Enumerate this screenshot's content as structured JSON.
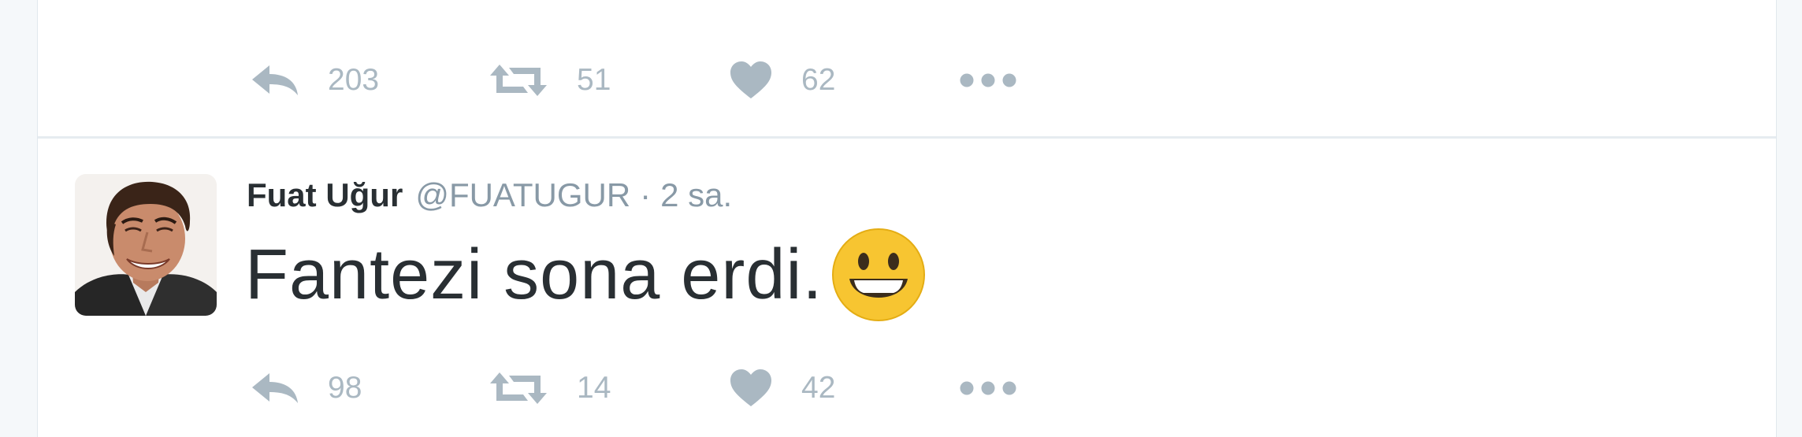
{
  "previous_tweet": {
    "actions": {
      "reply_count": "203",
      "retweet_count": "51",
      "like_count": "62"
    }
  },
  "tweet": {
    "author": {
      "fullname": "Fuat Uğur",
      "username": "@FUATUGUR"
    },
    "separator": "·",
    "timestamp": "2 sa.",
    "text": "Fantezi sona erdi.",
    "emoji": "grinning-face-emoji",
    "actions": {
      "reply_count": "98",
      "retweet_count": "14",
      "like_count": "42"
    }
  },
  "colors": {
    "action_icon": "#aab8c2",
    "fullname": "#292f33",
    "username": "#8899a6",
    "divider": "#e6ecf0",
    "page_background": "#f5f8fa"
  },
  "icons": [
    "reply-icon",
    "retweet-icon",
    "like-icon",
    "more-icon"
  ]
}
